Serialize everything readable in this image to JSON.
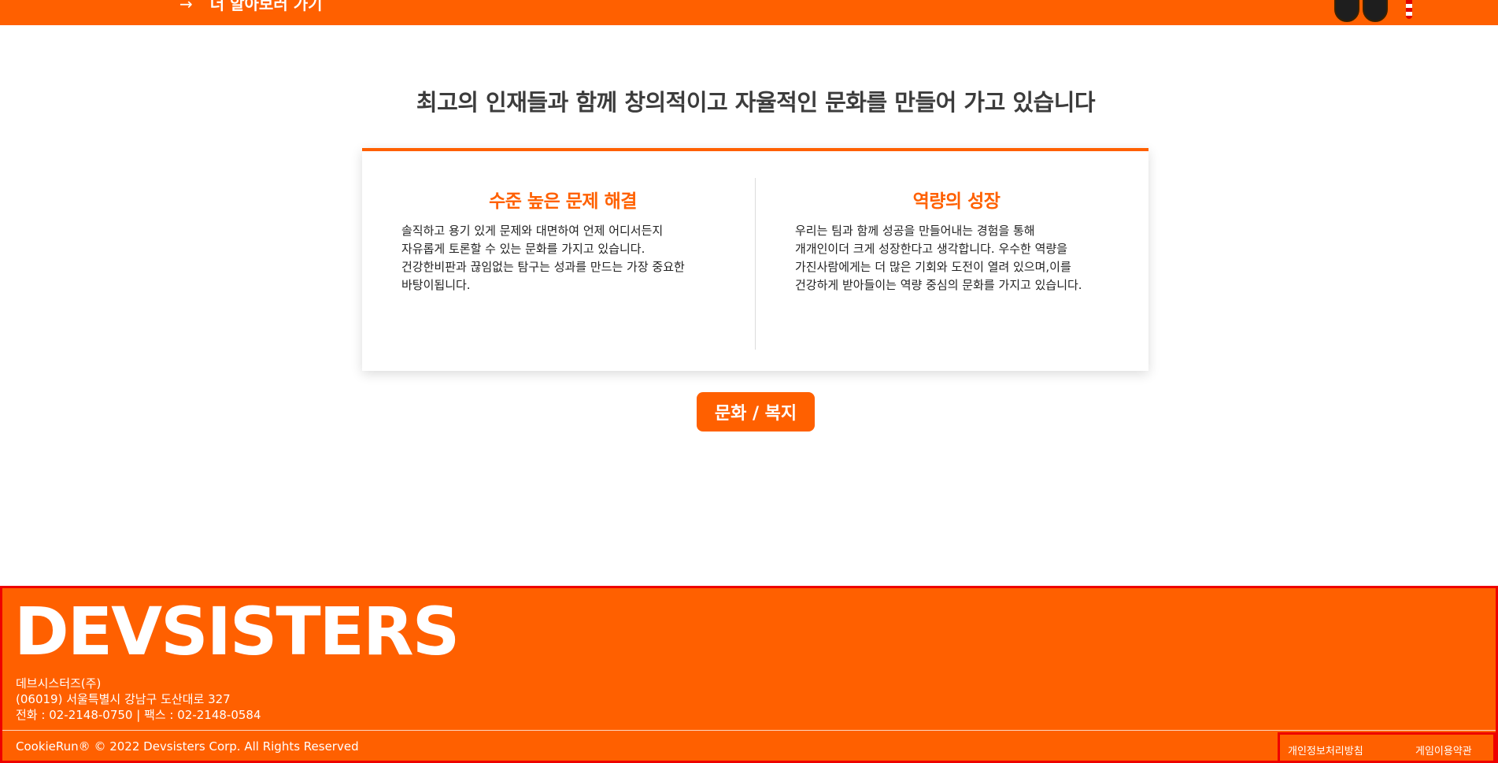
{
  "header": {
    "learn_more_arrow": "→",
    "learn_more_label": "더 알아보러 가기"
  },
  "main": {
    "headline": "최고의 인재들과 함께 창의적이고 자율적인 문화를 만들어 가고 있습니다",
    "values": [
      {
        "title": "수준 높은 문제 해결",
        "body": "솔직하고 용기 있게 문제와 대면하여 언제 어디서든지\n자유롭게 토론할 수 있는 문화를 가지고 있습니다.\n건강한비판과 끊임없는 탐구는 성과를 만드는 가장 중요한\n바탕이됩니다."
      },
      {
        "title": "역량의 성장",
        "body": "우리는 팀과 함께 성공을 만들어내는 경험을 통해\n개개인이더 크게 성장한다고 생각합니다. 우수한 역량을\n가진사람에게는 더 많은 기회와 도전이 열려 있으며,이를\n건강하게 받아들이는 역량 중심의 문화를 가지고 있습니다."
      }
    ],
    "culture_button": "문화 / 복지"
  },
  "footer": {
    "logo": "DEVSISTERS",
    "company": "데브시스터즈(주)",
    "address": "(06019) 서울특별시 강남구 도산대로 327",
    "contact": "전화 : 02-2148-0750 | 팩스 : 02-2148-0584",
    "copyright": "CookieRun® © 2022 Devsisters Corp. All Rights Reserved",
    "links": [
      "개인정보처리방침",
      "게임이용약관"
    ]
  },
  "colors": {
    "brand": "#ff6000",
    "highlight_border": "#ee0000"
  },
  "icons": [
    "right-arrow-icon",
    "boots-icon",
    "candy-cane-icon"
  ]
}
